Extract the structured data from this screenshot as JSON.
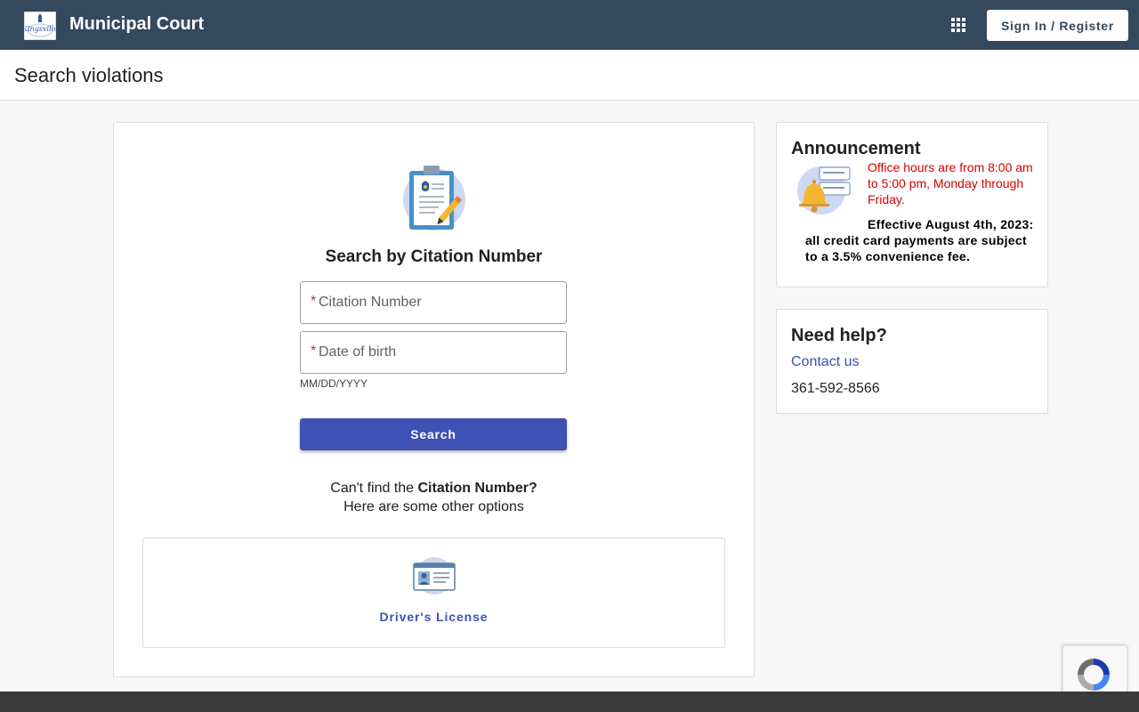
{
  "header": {
    "logo_text": "Kingsville",
    "title": "Municipal Court",
    "apps_icon": "apps-grid-icon",
    "signin_label": "Sign In / Register"
  },
  "page": {
    "title": "Search violations"
  },
  "search": {
    "title": "Search by Citation Number",
    "citation_placeholder": "Citation Number",
    "dob_placeholder": "Date of birth",
    "dob_hint": "MM/DD/YYYY",
    "button_label": "Search",
    "cant_find_prefix": "Can't find the ",
    "cant_find_bold": "Citation Number?",
    "other_options": "Here are some other options",
    "option_label": "Driver's License",
    "option_icon": "drivers-license-icon",
    "illustration_icon": "clipboard-badge-icon"
  },
  "announcement": {
    "title": "Announcement",
    "icon": "bell-notification-icon",
    "hours_text": "Office hours are from 8:00 am to 5:00 pm, Monday through Friday.",
    "fee_text": "Effective August 4th, 2023: all credit card payments are subject to a 3.5% convenience fee."
  },
  "help": {
    "title": "Need help?",
    "contact_label": "Contact us",
    "phone": "361-592-8566"
  },
  "colors": {
    "header_bg": "#34495e",
    "primary": "#3f51b5",
    "alert_red": "#d50000",
    "required_red": "#c62828"
  }
}
